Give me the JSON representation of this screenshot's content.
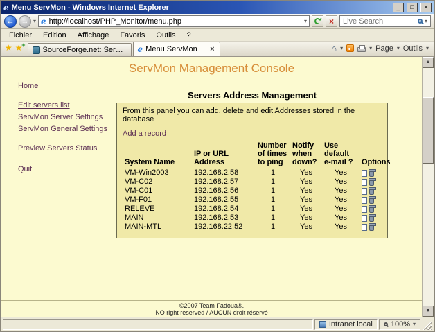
{
  "colors": {
    "accent_orange": "#D78E3A",
    "page_bg": "#FCFAD0",
    "panel_bg": "#F0E9A8",
    "link": "#5B2D52",
    "titlebar_blue": "#0A246A"
  },
  "icons": {
    "ie_e": "e",
    "back_arrow": "←",
    "forward_arrow": "→",
    "dropdown": "▾",
    "minimize": "_",
    "maximize": "□",
    "close": "×",
    "stop_x": "×",
    "star": "★",
    "star_plus": "+",
    "home": "⌂",
    "scroll_up": "▲",
    "scroll_down": "▼",
    "tab_close": "×"
  },
  "chrome": {
    "title": "Menu ServMon - Windows Internet Explorer",
    "address": {
      "value": "http://localhost/PHP_Monitor/menu.php"
    },
    "search": {
      "placeholder": "Live Search"
    },
    "menubar": [
      "Fichier",
      "Edition",
      "Affichage",
      "Favoris",
      "Outils",
      "?"
    ],
    "tabs": [
      {
        "label": "SourceForge.net: Server St..."
      },
      {
        "label": "Menu ServMon"
      }
    ],
    "toolbar_right": {
      "page": "Page",
      "tools": "Outils"
    },
    "status": {
      "zone": "Intranet local",
      "zoom": "100%"
    }
  },
  "page": {
    "title": "ServMon Management Console",
    "sidebar": [
      {
        "label": "Home"
      },
      {
        "label": "Edit servers list"
      },
      {
        "label": "ServMon Server Settings"
      },
      {
        "label": "ServMon General Settings"
      },
      {
        "label": "Preview Servers Status"
      },
      {
        "label": "Quit"
      }
    ],
    "section": {
      "heading": "Servers Address Management",
      "intro": "From this panel you can add, delete and edit Addresses stored in the database",
      "add_link": "Add a record",
      "table": {
        "headers": {
          "name": "System Name",
          "ip": "IP or URL Address",
          "ping": "Number of times to ping",
          "notify": "Notify when down?",
          "email": "Use default e-mail ?",
          "options": "Options"
        },
        "rows": [
          {
            "name": "VM-Win2003",
            "ip": "192.168.2.58",
            "ping": "1",
            "notify": "Yes",
            "email": "Yes"
          },
          {
            "name": "VM-C02",
            "ip": "192.168.2.57",
            "ping": "1",
            "notify": "Yes",
            "email": "Yes"
          },
          {
            "name": "VM-C01",
            "ip": "192.168.2.56",
            "ping": "1",
            "notify": "Yes",
            "email": "Yes"
          },
          {
            "name": "VM-F01",
            "ip": "192.168.2.55",
            "ping": "1",
            "notify": "Yes",
            "email": "Yes"
          },
          {
            "name": "RELEVE",
            "ip": "192.168.2.54",
            "ping": "1",
            "notify": "Yes",
            "email": "Yes"
          },
          {
            "name": "MAIN",
            "ip": "192.168.2.53",
            "ping": "1",
            "notify": "Yes",
            "email": "Yes"
          },
          {
            "name": "MAIN-MTL",
            "ip": "192.168.22.52",
            "ping": "1",
            "notify": "Yes",
            "email": "Yes"
          }
        ]
      }
    },
    "footer": {
      "line1": "©2007 Team Fadoua®.",
      "line2": "NO right reserved / AUCUN droit réservé"
    }
  }
}
